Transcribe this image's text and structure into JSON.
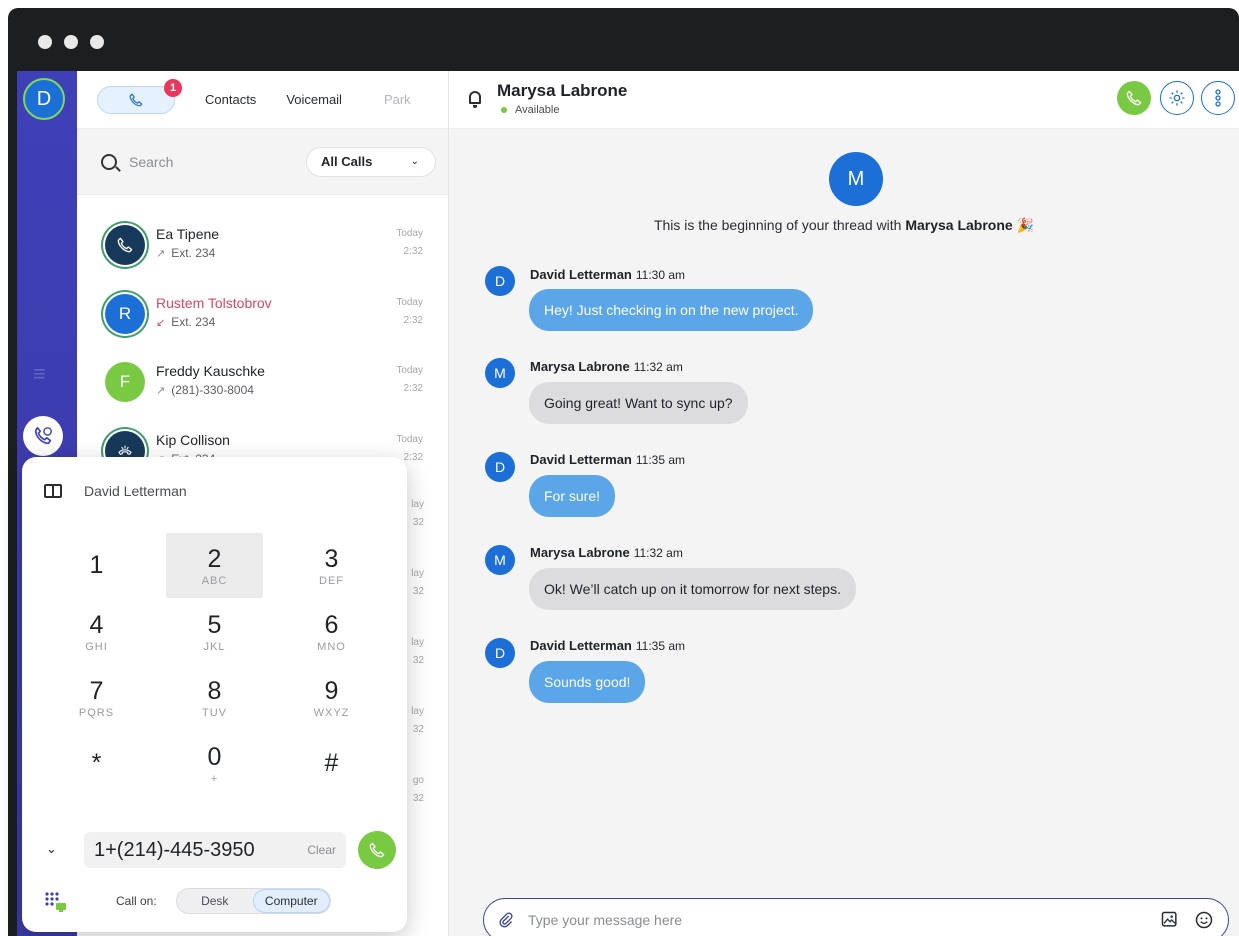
{
  "nav": {
    "user_initial": "D",
    "badge_count": "1"
  },
  "tabs": [
    {
      "label": "Contacts"
    },
    {
      "label": "Voicemail"
    },
    {
      "label": "Park"
    }
  ],
  "search": {
    "placeholder": "Search",
    "filter_label": "All Calls"
  },
  "calls": [
    {
      "initial": "",
      "name": "Ea Tipene",
      "detail": "Ext. 234",
      "day": "Today",
      "time": "2:32",
      "missed": false
    },
    {
      "initial": "R",
      "name": "Rustem Tolstobrov",
      "detail": "Ext. 234",
      "day": "Today",
      "time": "2:32",
      "missed": true
    },
    {
      "initial": "F",
      "name": "Freddy Kauschke",
      "detail": "(281)-330-8004",
      "day": "Today",
      "time": "2:32",
      "missed": false
    },
    {
      "initial": "",
      "name": "Kip Collison",
      "detail": "Ext. 234",
      "day": "Today",
      "time": "2:32",
      "missed": false
    }
  ],
  "hidden_call_times": [
    {
      "day": "lay",
      "time": "32"
    },
    {
      "day": "lay",
      "time": "32"
    },
    {
      "day": "lay",
      "time": "32"
    },
    {
      "day": "lay",
      "time": "32"
    },
    {
      "day": "go",
      "time": "32"
    }
  ],
  "dialer": {
    "contact_name": "David Letterman",
    "keys": [
      {
        "digit": "1",
        "letters": ""
      },
      {
        "digit": "2",
        "letters": "ABC"
      },
      {
        "digit": "3",
        "letters": "DEF"
      },
      {
        "digit": "4",
        "letters": "GHI"
      },
      {
        "digit": "5",
        "letters": "JKL"
      },
      {
        "digit": "6",
        "letters": "MNO"
      },
      {
        "digit": "7",
        "letters": "PQRS"
      },
      {
        "digit": "8",
        "letters": "TUV"
      },
      {
        "digit": "9",
        "letters": "WXYZ"
      },
      {
        "digit": "*",
        "letters": ""
      },
      {
        "digit": "0",
        "letters": "+"
      },
      {
        "digit": "#",
        "letters": ""
      }
    ],
    "number": "1+(214)-445-3950",
    "clear_label": "Clear",
    "call_on_label": "Call on:",
    "call_on_options": [
      "Desk",
      "Computer"
    ],
    "call_on_selected": "Computer"
  },
  "chat": {
    "contact_name": "Marysa Labrone",
    "contact_initial": "M",
    "status": "Available",
    "thread_intro": "This is the beginning of your thread with",
    "thread_intro_name": "Marysa Labrone",
    "thread_intro_emoji": "🎉",
    "messages": [
      {
        "initial": "D",
        "author": "David Letterman",
        "time": "11:30 am",
        "text": "Hey! Just checking in on the new project.",
        "mine": true
      },
      {
        "initial": "M",
        "author": "Marysa Labrone",
        "time": "11:32 am",
        "text": "Going great! Want to sync up?",
        "mine": false
      },
      {
        "initial": "D",
        "author": "David Letterman",
        "time": "11:35 am",
        "text": "For sure!",
        "mine": true
      },
      {
        "initial": "M",
        "author": "Marysa Labrone",
        "time": "11:32 am",
        "text": "Ok! We’ll catch up on it tomorrow for next steps.",
        "mine": false
      },
      {
        "initial": "D",
        "author": "David Letterman",
        "time": "11:35 am",
        "text": "Sounds good!",
        "mine": true
      }
    ],
    "composer_placeholder": "Type your message here"
  },
  "colors": {
    "brand_blue": "#1c6fd6",
    "rail_purple": "#3f3fb8",
    "call_green": "#7ac943",
    "missed_red": "#e0455e",
    "bubble_mine": "#5aa6e8",
    "bubble_theirs": "#dcdcde"
  }
}
